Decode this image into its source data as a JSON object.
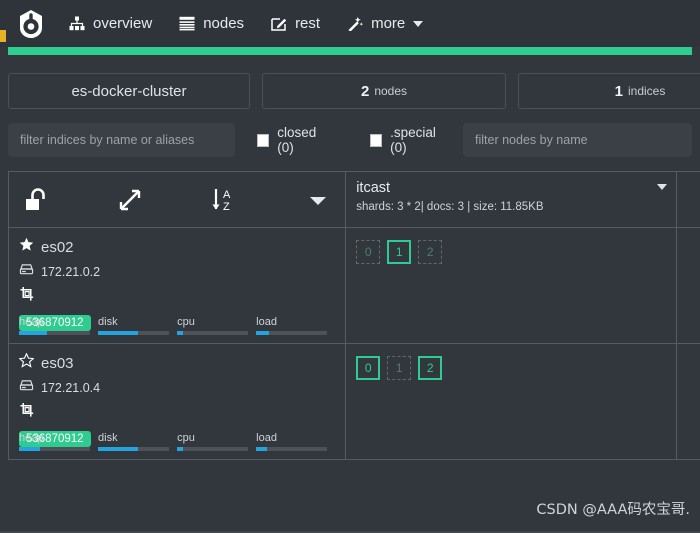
{
  "navbar": {
    "logo_icon": "cerebro-logo-icon",
    "items": [
      {
        "label": "overview",
        "icon": "sitemap-icon"
      },
      {
        "label": "nodes",
        "icon": "server-list-icon"
      },
      {
        "label": "rest",
        "icon": "edit-square-icon"
      },
      {
        "label": "more",
        "icon": "magic-wand-icon",
        "has_caret": true
      }
    ],
    "health_color": "#2ecc8f",
    "accent_color": "#e6b422"
  },
  "cards": {
    "cluster": {
      "name": "es-docker-cluster"
    },
    "nodes": {
      "count": "2",
      "label": "nodes"
    },
    "indices": {
      "count": "1",
      "label": "indices"
    }
  },
  "filters": {
    "indices_placeholder": "filter indices by name or aliases",
    "closed_label": "closed (0)",
    "special_label": ".special (0)",
    "nodes_placeholder": "filter nodes by name"
  },
  "toolbar": {
    "lock_icon": "unlock-icon",
    "expand_icon": "expand-arrows-icon",
    "sort_icon": "sort-alpha-asc-icon",
    "menu_icon": "chevron-down-icon"
  },
  "indices": [
    {
      "name": "itcast",
      "meta": "shards: 3 * 2| docs: 3 | size: 11.85KB"
    }
  ],
  "nodes": [
    {
      "name": "es02",
      "master": true,
      "star_icon": "star-filled-icon",
      "ip": "172.21.0.2",
      "ip_icon": "server-icon",
      "role_icon": "data-node-icon",
      "badge": "536870912",
      "metrics": [
        {
          "label": "heap",
          "pct": 40
        },
        {
          "label": "disk",
          "pct": 56
        },
        {
          "label": "cpu",
          "pct": 8
        },
        {
          "label": "load",
          "pct": 18
        }
      ],
      "shards": [
        {
          "num": "0",
          "type": "replica"
        },
        {
          "num": "1",
          "type": "primary"
        },
        {
          "num": "2",
          "type": "replica"
        }
      ]
    },
    {
      "name": "es03",
      "master": false,
      "star_icon": "star-outline-icon",
      "ip": "172.21.0.4",
      "ip_icon": "server-icon",
      "role_icon": "data-node-icon",
      "badge": "536870912",
      "metrics": [
        {
          "label": "heap",
          "pct": 30
        },
        {
          "label": "disk",
          "pct": 56
        },
        {
          "label": "cpu",
          "pct": 8
        },
        {
          "label": "load",
          "pct": 15
        }
      ],
      "shards": [
        {
          "num": "0",
          "type": "primary"
        },
        {
          "num": "1",
          "type": "replica"
        },
        {
          "num": "2",
          "type": "primary"
        }
      ]
    }
  ],
  "watermark": {
    "text": "CSDN @AAA码农宝哥."
  },
  "colors": {
    "green": "#2ecc8f",
    "blue": "#23a3e0",
    "bg": "#31373d",
    "navbar_bg": "#2f343a",
    "border": "#555b61"
  }
}
